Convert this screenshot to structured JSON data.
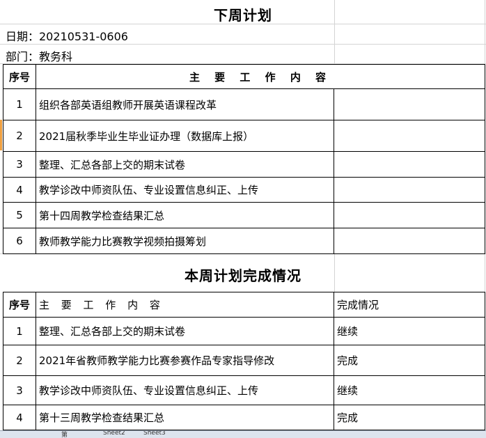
{
  "next_week": {
    "title": "下周计划",
    "date_line": "日期：20210531-0606",
    "dept_line": "部门：教务科",
    "header_num": "序号",
    "header_main": "主 要 工 作 内 容",
    "rows": [
      {
        "num": "1",
        "task": "组织各部英语组教师开展英语课程改革"
      },
      {
        "num": "2",
        "task": "2021届秋季毕业生毕业证办理（数据库上报）"
      },
      {
        "num": "3",
        "task": "整理、汇总各部上交的期末试卷"
      },
      {
        "num": "4",
        "task": "教学诊改中师资队伍、专业设置信息纠正、上传"
      },
      {
        "num": "5",
        "task": "第十四周教学检查结果汇总"
      },
      {
        "num": "6",
        "task": "教师教学能力比赛教学视频拍摄筹划"
      }
    ]
  },
  "this_week": {
    "title": "本周计划完成情况",
    "header_num": "序号",
    "header_main": "主 要 工 作 内 容",
    "header_status": "完成情况",
    "rows": [
      {
        "num": "1",
        "task": "整理、汇总各部上交的期末试卷",
        "status": "继续"
      },
      {
        "num": "2",
        "task": "2021年省教师教学能力比赛参赛作品专家指导修改",
        "status": "完成"
      },
      {
        "num": "3",
        "task": "教学诊改中师资队伍、专业设置信息纠正、上传",
        "status": "继续"
      },
      {
        "num": "4",
        "task": "第十三周教学检查结果汇总",
        "status": "完成"
      }
    ]
  },
  "sheet_tabs": [
    "第",
    "Sheet2",
    "Sheet3"
  ]
}
